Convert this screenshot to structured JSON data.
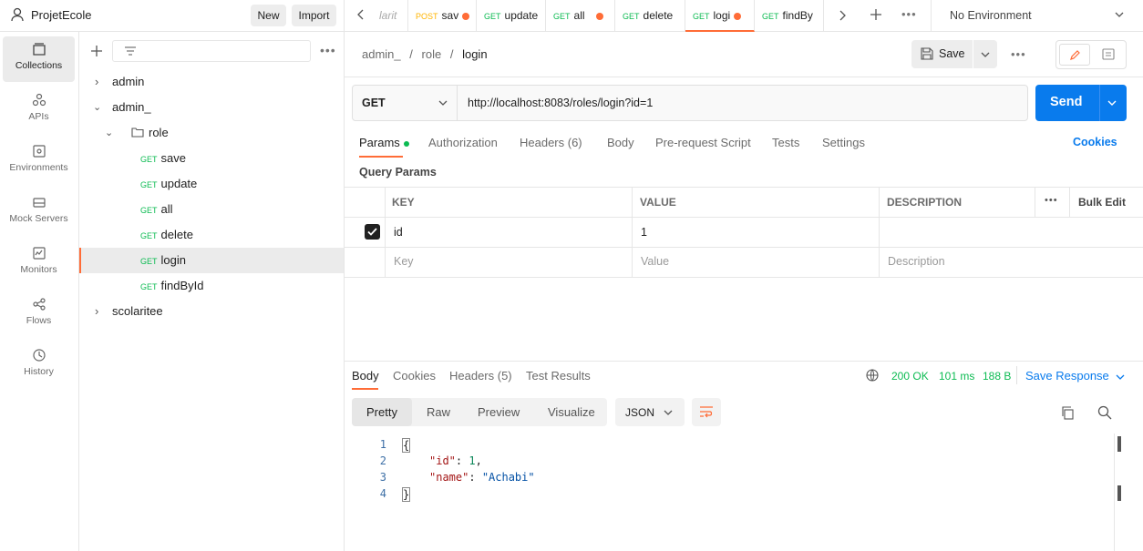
{
  "workspace": {
    "name": "ProjetEcole",
    "new_label": "New",
    "import_label": "Import"
  },
  "rail": [
    {
      "label": "Collections",
      "icon": "collections-icon"
    },
    {
      "label": "APIs",
      "icon": "apis-icon"
    },
    {
      "label": "Environments",
      "icon": "environments-icon"
    },
    {
      "label": "Mock Servers",
      "icon": "mock-servers-icon"
    },
    {
      "label": "Monitors",
      "icon": "monitors-icon"
    },
    {
      "label": "Flows",
      "icon": "flows-icon"
    },
    {
      "label": "History",
      "icon": "history-icon"
    }
  ],
  "tree": {
    "folders": [
      "admin",
      "admin_",
      "role",
      "scolaritee"
    ],
    "requests": [
      {
        "method": "GET",
        "name": "save"
      },
      {
        "method": "GET",
        "name": "update"
      },
      {
        "method": "GET",
        "name": "all"
      },
      {
        "method": "GET",
        "name": "delete"
      },
      {
        "method": "GET",
        "name": "login"
      },
      {
        "method": "GET",
        "name": "findById"
      }
    ]
  },
  "tabs": [
    {
      "method": "",
      "name": "larit"
    },
    {
      "method": "POST",
      "name": "sav"
    },
    {
      "method": "GET",
      "name": "update"
    },
    {
      "method": "GET",
      "name": "all"
    },
    {
      "method": "GET",
      "name": "delete"
    },
    {
      "method": "GET",
      "name": "logi"
    },
    {
      "method": "GET",
      "name": "findBy"
    }
  ],
  "environment": "No Environment",
  "breadcrumb": {
    "a": "admin_",
    "b": "role",
    "c": "login",
    "sep": "/"
  },
  "save_label": "Save",
  "request": {
    "method": "GET",
    "url": "http://localhost:8083/roles/login?id=1",
    "send_label": "Send"
  },
  "req_tabs": [
    "Params",
    "Authorization",
    "Headers (6)",
    "Body",
    "Pre-request Script",
    "Tests",
    "Settings"
  ],
  "cookies_label": "Cookies",
  "query_params_label": "Query Params",
  "params_table": {
    "headers": [
      "KEY",
      "VALUE",
      "DESCRIPTION"
    ],
    "bulk_edit": "Bulk Edit",
    "row": {
      "key": "id",
      "value": "1",
      "description": ""
    },
    "placeholders": {
      "key": "Key",
      "value": "Value",
      "description": "Description"
    }
  },
  "response": {
    "tabs": [
      "Body",
      "Cookies",
      "Headers (5)",
      "Test Results"
    ],
    "status": "200 OK",
    "time": "101 ms",
    "size": "188 B",
    "save_response": "Save Response",
    "views": [
      "Pretty",
      "Raw",
      "Preview",
      "Visualize"
    ],
    "format": "JSON",
    "lines": [
      "{",
      "\"id\": 1,",
      "\"name\": \"Achabi\"",
      "}"
    ],
    "line_numbers": [
      "1",
      "2",
      "3",
      "4"
    ],
    "json": {
      "k1": "\"id\"",
      "v1": "1",
      "k2": "\"name\"",
      "v2": "\"Achabi\""
    }
  },
  "colors": {
    "accent": "#ff6c37",
    "send": "#097bed",
    "get": "#0cbb52",
    "status_ok": "#0cbb52"
  }
}
